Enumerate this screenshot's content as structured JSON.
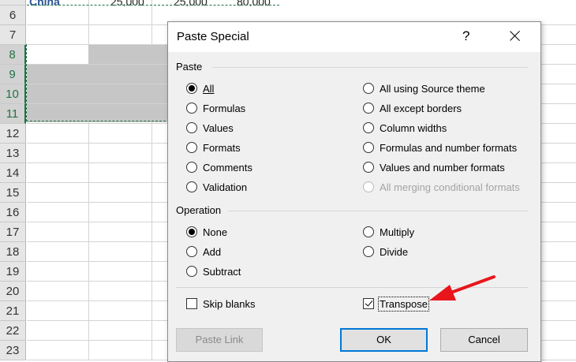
{
  "spreadsheet": {
    "top_row_cells": {
      "name": "China",
      "num1": "25,000",
      "num2": "25,000",
      "num3": "80,000"
    },
    "row_numbers": [
      "6",
      "7",
      "8",
      "9",
      "10",
      "11",
      "12",
      "13",
      "14",
      "15",
      "16",
      "17",
      "18",
      "19",
      "20",
      "21",
      "22",
      "23"
    ],
    "selected_rows": [
      "8",
      "9",
      "10",
      "11"
    ]
  },
  "dialog": {
    "title": "Paste Special",
    "help_icon": "?",
    "paste_group_label": "Paste",
    "paste_options_left": [
      "All",
      "Formulas",
      "Values",
      "Formats",
      "Comments",
      "Validation"
    ],
    "paste_options_right": [
      "All using Source theme",
      "All except borders",
      "Column widths",
      "Formulas and number formats",
      "Values and number formats",
      "All merging conditional formats"
    ],
    "paste_selected": "All",
    "operation_group_label": "Operation",
    "operation_options_left": [
      "None",
      "Add",
      "Subtract"
    ],
    "operation_options_right": [
      "Multiply",
      "Divide"
    ],
    "operation_selected": "None",
    "skip_blanks_label": "Skip blanks",
    "skip_blanks_checked": false,
    "transpose_label": "Transpose",
    "transpose_checked": true,
    "buttons": {
      "paste_link": "Paste Link",
      "ok": "OK",
      "cancel": "Cancel"
    }
  },
  "annotation": {
    "arrow_color": "#e8161c",
    "icon": "red-arrow-icon"
  },
  "colors": {
    "accent_green": "#217346",
    "default_button_border": "#0078d7"
  }
}
